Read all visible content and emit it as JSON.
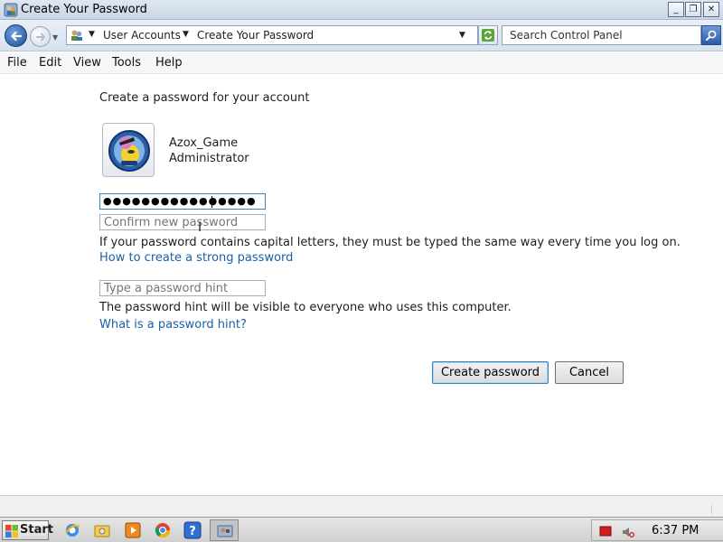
{
  "window": {
    "title": "Create Your Password",
    "controls": {
      "minimize": "_",
      "maximize": "❐",
      "close": "✕"
    }
  },
  "address_bar": {
    "breadcrumbs": [
      "User Accounts",
      "Create Your Password"
    ],
    "search_placeholder": "Search Control Panel",
    "icons": [
      "back-icon",
      "forward-icon",
      "control-panel-icon",
      "refresh-icon",
      "search-icon"
    ]
  },
  "menu": {
    "items": [
      "File",
      "Edit",
      "View",
      "Tools",
      "Help"
    ]
  },
  "main": {
    "heading": "Create a password for your account",
    "user": {
      "name": "Azox_Game",
      "role": "Administrator"
    },
    "new_password": {
      "masked_value": "●●●●●●●●●●●●●●●●"
    },
    "confirm_password": {
      "placeholder": "Confirm new password"
    },
    "capital_letters_note": "If your password contains capital letters, they must be typed the same way every time you log on.",
    "strong_password_link": "How to create a strong password",
    "hint": {
      "placeholder": "Type a password hint"
    },
    "hint_note": "The password hint will be visible to everyone who uses this computer.",
    "hint_link": "What is a password hint?",
    "buttons": {
      "create": "Create password",
      "cancel": "Cancel"
    }
  },
  "taskbar": {
    "start_label": "Start",
    "clock": "6:37 PM",
    "pinned": [
      "ie-icon",
      "explorer-icon",
      "media-player-icon",
      "chrome-icon",
      "help-icon",
      "user-accounts-window-icon"
    ],
    "tray": [
      "flag-icon",
      "volume-muted-icon"
    ]
  },
  "colors": {
    "link": "#1a5fa8",
    "focus_border": "#3c7fb1",
    "titlebar": "#dfe7f1"
  }
}
